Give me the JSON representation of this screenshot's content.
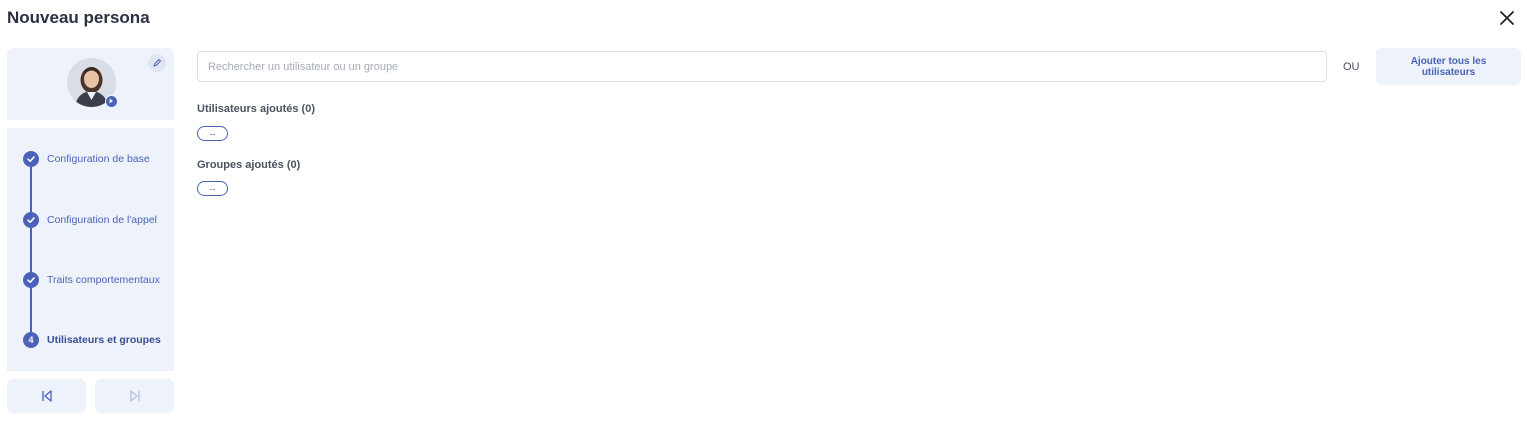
{
  "header": {
    "title": "Nouveau persona"
  },
  "icons": {
    "close": "close-icon",
    "edit": "pencil-icon",
    "avatar_badge": "play-icon",
    "check": "check-icon",
    "prev": "skip-back-icon",
    "next": "skip-forward-icon"
  },
  "steps": [
    {
      "label": "Configuration de base",
      "status": "done"
    },
    {
      "label": "Configuration de l'appel",
      "status": "done"
    },
    {
      "label": "Traits comportementaux",
      "status": "done"
    },
    {
      "label": "Utilisateurs et groupes",
      "status": "active",
      "number": "4"
    }
  ],
  "search": {
    "placeholder": "Rechercher un utilisateur ou un groupe",
    "value": ""
  },
  "or_label": "OU",
  "add_all_label": "Ajouter tous les utilisateurs",
  "users_section": {
    "title": "Utilisateurs ajoutés (0)",
    "empty_chip": "--"
  },
  "groups_section": {
    "title": "Groupes ajoutés (0)",
    "empty_chip": "--"
  },
  "colors": {
    "accent": "#4a63b8",
    "panel": "#eef2fa",
    "border": "#d8deea"
  }
}
